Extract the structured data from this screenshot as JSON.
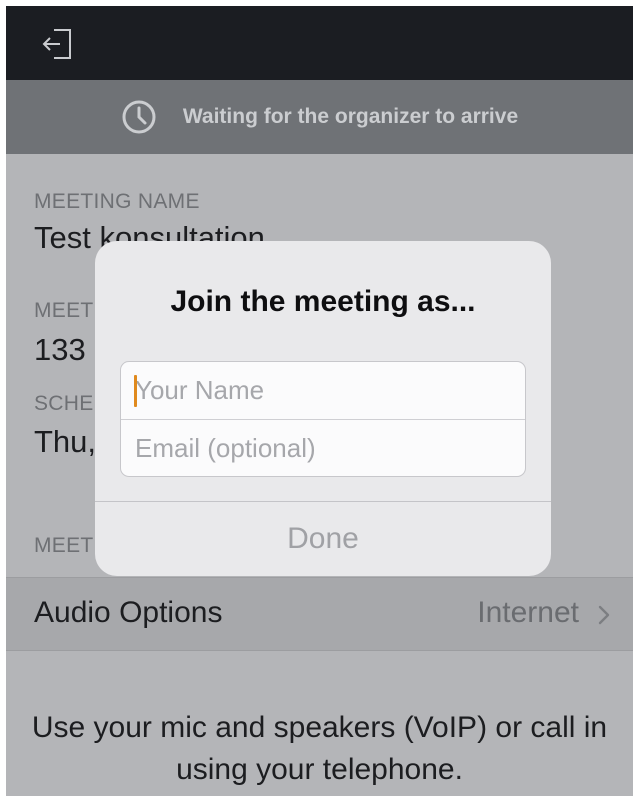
{
  "top_bar": {
    "exit_icon": "exit-door-icon"
  },
  "banner": {
    "icon": "clock-icon",
    "text": "Waiting for the organizer to arrive"
  },
  "details": {
    "meeting_name_label": "MEETING NAME",
    "meeting_name_value": "Test konsultation",
    "meeting_number_label": "MEET",
    "meeting_number_value": "133",
    "scheduled_label": "SCHE",
    "scheduled_value": "Thu,",
    "section_label": "MEET"
  },
  "audio": {
    "label": "Audio Options",
    "value": "Internet",
    "chevron_icon": "chevron-right-icon"
  },
  "footer": {
    "text": "Use your mic and speakers (VoIP) or call in using your telephone."
  },
  "dialog": {
    "title": "Join the meeting as...",
    "name_placeholder": "Your Name",
    "email_placeholder": "Email (optional)",
    "done_label": "Done"
  },
  "colors": {
    "top_bar": "#1b1d22",
    "banner": "#6f7276",
    "caret": "#e08a1e"
  }
}
